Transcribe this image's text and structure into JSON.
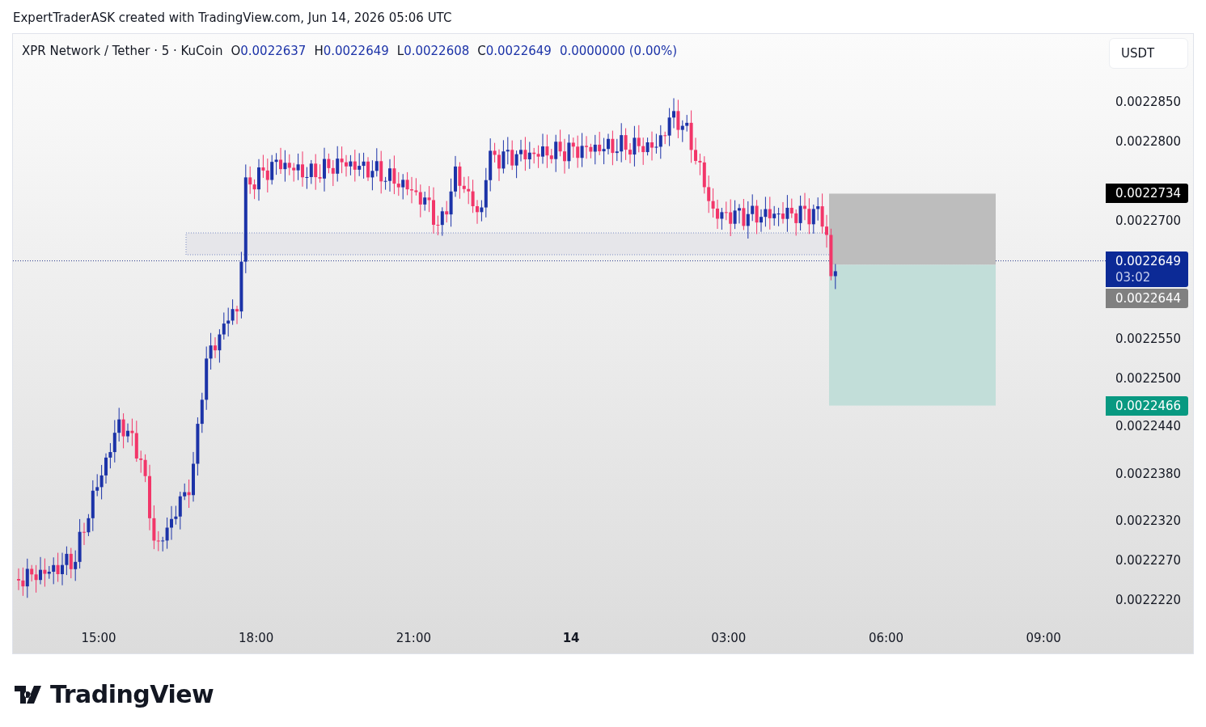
{
  "caption": "ExpertTraderASK created with TradingView.com, Jun 14, 2026 05:06 UTC",
  "legend": {
    "symbol": "XPR Network / Tether · 5 · KuCoin",
    "values": [
      {
        "label": "O",
        "value": "0.0022637"
      },
      {
        "label": "H",
        "value": "0.0022649"
      },
      {
        "label": "L",
        "value": "0.0022608"
      },
      {
        "label": "C",
        "value": "0.0022649"
      }
    ],
    "change": "0.0000000 (0.00%)"
  },
  "currency_button": "USDT",
  "price_axis": {
    "ticks": [
      "0.0022850",
      "0.0022800",
      "0.0022700",
      "0.0022550",
      "0.0022500",
      "0.0022440",
      "0.0022380",
      "0.0022320",
      "0.0022270",
      "0.0022220"
    ]
  },
  "price_labels": [
    {
      "kind": "stop",
      "text": "0.0022734"
    },
    {
      "kind": "last",
      "text": "0.0022649",
      "countdown": "03:02"
    },
    {
      "kind": "entry",
      "text": "0.0022644"
    },
    {
      "kind": "target",
      "text": "0.0022466"
    }
  ],
  "time_axis": {
    "ticks": [
      {
        "label": "15:00",
        "bold": false
      },
      {
        "label": "18:00",
        "bold": false
      },
      {
        "label": "21:00",
        "bold": false
      },
      {
        "label": "14",
        "bold": true
      },
      {
        "label": "03:00",
        "bold": false
      },
      {
        "label": "06:00",
        "bold": false
      },
      {
        "label": "09:00",
        "bold": false
      }
    ]
  },
  "footer": {
    "logo": "TradingView"
  }
}
